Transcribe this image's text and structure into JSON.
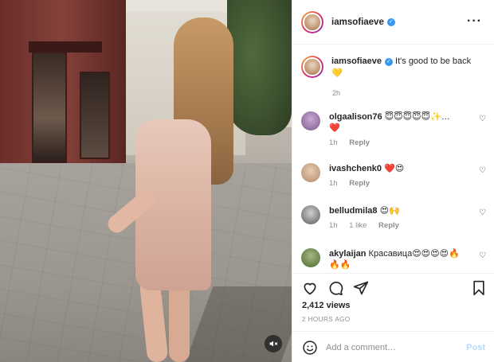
{
  "post": {
    "username": "iamsofiaeve",
    "caption_username": "iamsofiaeve",
    "caption_text": "It's good to be back",
    "caption_emoji": "💛",
    "caption_time": "2h",
    "views": "2,412 views",
    "posted_ago": "2 HOURS AGO"
  },
  "comments": [
    {
      "username": "olgaalison76",
      "text": "😇😇😇😇😇✨…",
      "text2": "❤️",
      "time": "1h",
      "likes": "",
      "reply": "Reply",
      "avatar_color": "#7d5a8c"
    },
    {
      "username": "ivashchenk0",
      "text": "❤️😍",
      "time": "1h",
      "likes": "",
      "reply": "Reply",
      "avatar_color": "#b08a6a"
    },
    {
      "username": "belludmila8",
      "text": "😍🙌",
      "time": "1h",
      "likes": "1 like",
      "reply": "Reply",
      "avatar_color": "#6b6b6b"
    },
    {
      "username": "akylaijan",
      "text": "Красавица😍😍😍😍🔥",
      "text2": "🔥🔥",
      "time": "",
      "likes": "",
      "reply": "",
      "avatar_color": "#4a6b2f"
    }
  ],
  "comment_box": {
    "placeholder": "Add a comment…",
    "post_label": "Post"
  },
  "icons": {
    "more": "more-options-icon",
    "verified": "verified-badge-icon",
    "like": "heart-icon",
    "comment": "comment-icon",
    "share": "share-icon",
    "save": "bookmark-icon",
    "emoji": "emoji-icon",
    "mute": "muted-speaker-icon"
  },
  "colors": {
    "accent": "#3897f0",
    "post_button": "#b3dbff",
    "muted_text": "#8e8e8e"
  }
}
